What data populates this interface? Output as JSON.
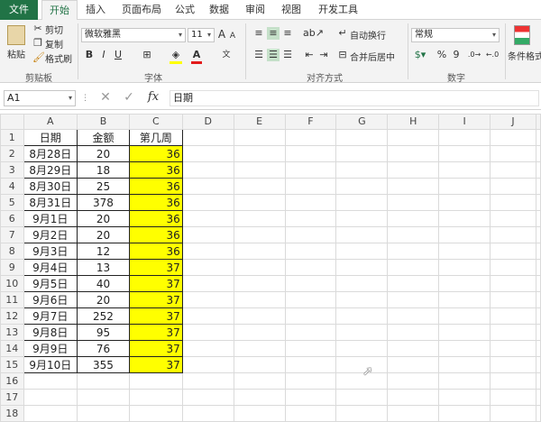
{
  "tabs": [
    {
      "label": "文件"
    },
    {
      "label": "开始"
    },
    {
      "label": "插入"
    },
    {
      "label": "页面布局"
    },
    {
      "label": "公式"
    },
    {
      "label": "数据"
    },
    {
      "label": "审阅"
    },
    {
      "label": "视图"
    },
    {
      "label": "开发工具"
    }
  ],
  "ribbon": {
    "clipboard": {
      "paste": "粘贴",
      "cut": "剪切",
      "copy": "复制",
      "format_painter": "格式刷",
      "group": "剪贴板"
    },
    "font": {
      "name": "微软雅黑",
      "size": "11",
      "bold": "B",
      "italic": "I",
      "underline": "U",
      "group": "字体",
      "grow": "A",
      "shrink": "A",
      "font_color": "A"
    },
    "alignment": {
      "wrap": "自动换行",
      "merge": "合并后居中",
      "group": "对齐方式"
    },
    "number": {
      "format": "常规",
      "percent": "%",
      "comma": "9",
      "group": "数字"
    },
    "styles": {
      "conditional": "条件格式"
    }
  },
  "formula_bar": {
    "name_box": "A1",
    "fx": "fx",
    "content": "日期"
  },
  "columns": [
    "A",
    "B",
    "C",
    "D",
    "E",
    "F",
    "G",
    "H",
    "I",
    "J"
  ],
  "rows": [
    [
      "日期",
      "金额",
      "第几周"
    ],
    [
      "8月28日",
      "20",
      "36"
    ],
    [
      "8月29日",
      "18",
      "36"
    ],
    [
      "8月30日",
      "25",
      "36"
    ],
    [
      "8月31日",
      "378",
      "36"
    ],
    [
      "9月1日",
      "20",
      "36"
    ],
    [
      "9月2日",
      "20",
      "36"
    ],
    [
      "9月3日",
      "12",
      "36"
    ],
    [
      "9月4日",
      "13",
      "37"
    ],
    [
      "9月5日",
      "40",
      "37"
    ],
    [
      "9月6日",
      "20",
      "37"
    ],
    [
      "9月7日",
      "252",
      "37"
    ],
    [
      "9月8日",
      "95",
      "37"
    ],
    [
      "9月9日",
      "76",
      "37"
    ],
    [
      "9月10日",
      "355",
      "37"
    ],
    [
      "",
      "",
      ""
    ],
    [
      "",
      "",
      ""
    ],
    [
      "",
      "",
      ""
    ]
  ],
  "colors": {
    "file_tab": "#217346",
    "highlight": "#ffff00"
  }
}
